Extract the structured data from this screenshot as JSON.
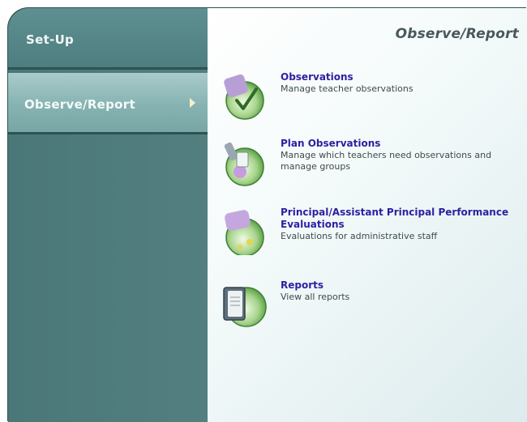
{
  "sidebar": {
    "items": [
      {
        "label": "Set-Up",
        "selected": false
      },
      {
        "label": "Observe/Report",
        "selected": true
      }
    ]
  },
  "main": {
    "title": "Observe/Report",
    "items": [
      {
        "title": "Observations",
        "description": "Manage teacher observations",
        "icon": "clipboard-check-icon"
      },
      {
        "title": "Plan Observations",
        "description": "Manage which teachers need observations and manage groups",
        "icon": "plan-clipboard-icon"
      },
      {
        "title": "Principal/Assistant Principal Performance Evaluations",
        "description": "Evaluations for administrative staff",
        "icon": "principal-evaluation-icon"
      },
      {
        "title": "Reports",
        "description": "View all reports",
        "icon": "report-book-icon"
      }
    ]
  },
  "colors": {
    "sidebar": "#4c7b7c",
    "selected_nav": "#86b3b2",
    "link": "#2d1fa2"
  }
}
